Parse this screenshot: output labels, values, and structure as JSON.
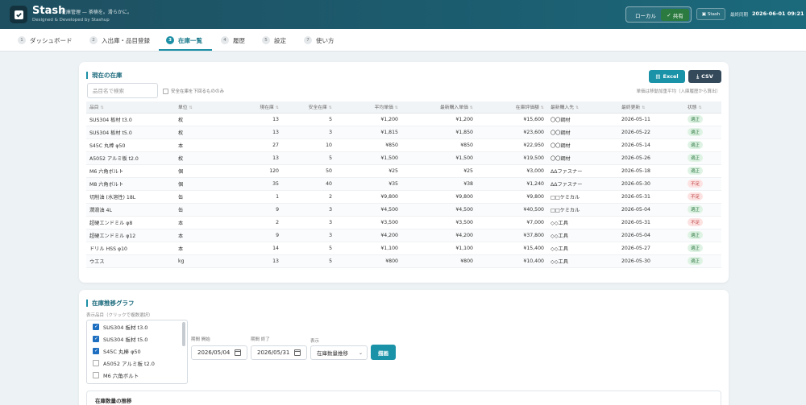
{
  "header": {
    "brand": "Stash",
    "tagline": "在庫管理 — 茶楠を。滑らかに。",
    "credit": "Designed & Developed by Stashup",
    "mode_local": "ローカル",
    "mode_shared": "共有",
    "stash_button": "Stash",
    "sync_label": "最終同期",
    "sync_time": "2026-06-01 09:21"
  },
  "tabs": [
    {
      "num": "1",
      "label": "ダッシュボード"
    },
    {
      "num": "2",
      "label": "入出庫・品目登録"
    },
    {
      "num": "3",
      "label": "在庫一覧"
    },
    {
      "num": "4",
      "label": "履歴"
    },
    {
      "num": "5",
      "label": "設定"
    },
    {
      "num": "7",
      "label": "使い方"
    }
  ],
  "inventory": {
    "title": "現在の在庫",
    "search_placeholder": "品目名で検索",
    "safety_filter_label": "安全在庫を下回るもののみ",
    "excel_label": "Excel",
    "csv_label": "CSV",
    "unit_note": "単価は移動加重平均（入庫履歴から算出）",
    "columns": [
      "品目",
      "単位",
      "現在庫",
      "安全在庫",
      "平均単価",
      "最新購入単価",
      "在庫評価額",
      "最新購入先",
      "最終更新",
      "状態"
    ],
    "rows": [
      [
        "SUS304 板材 t3.0",
        "枚",
        "13",
        "5",
        "¥1,200",
        "¥1,200",
        "¥15,600",
        "〇〇鋼材",
        "2026-05-11",
        "適正"
      ],
      [
        "SUS304 板材 t5.0",
        "枚",
        "13",
        "3",
        "¥1,815",
        "¥1,850",
        "¥23,600",
        "〇〇鋼材",
        "2026-05-22",
        "適正"
      ],
      [
        "S45C 丸棒 φ50",
        "本",
        "27",
        "10",
        "¥850",
        "¥850",
        "¥22,950",
        "〇〇鋼材",
        "2026-05-14",
        "適正"
      ],
      [
        "A5052 アルミ板 t2.0",
        "枚",
        "13",
        "5",
        "¥1,500",
        "¥1,500",
        "¥19,500",
        "〇〇鋼材",
        "2026-05-26",
        "適正"
      ],
      [
        "M6 六角ボルト",
        "個",
        "120",
        "50",
        "¥25",
        "¥25",
        "¥3,000",
        "ΔΔファスナー",
        "2026-05-18",
        "適正"
      ],
      [
        "M8 六角ボルト",
        "個",
        "35",
        "40",
        "¥35",
        "¥38",
        "¥1,240",
        "ΔΔファスナー",
        "2026-05-30",
        "不足"
      ],
      [
        "切削油 (水溶性) 18L",
        "缶",
        "1",
        "2",
        "¥9,800",
        "¥9,800",
        "¥9,800",
        "□□ケミカル",
        "2026-05-31",
        "不足"
      ],
      [
        "潤滑油 4L",
        "缶",
        "9",
        "3",
        "¥4,500",
        "¥4,500",
        "¥40,500",
        "□□ケミカル",
        "2026-05-04",
        "適正"
      ],
      [
        "超硬エンドミル φ8",
        "本",
        "2",
        "3",
        "¥3,500",
        "¥3,500",
        "¥7,000",
        "◇◇工具",
        "2026-05-31",
        "不足"
      ],
      [
        "超硬エンドミル φ12",
        "本",
        "9",
        "3",
        "¥4,200",
        "¥4,200",
        "¥37,800",
        "◇◇工具",
        "2026-05-04",
        "適正"
      ],
      [
        "ドリル HSS φ10",
        "本",
        "14",
        "5",
        "¥1,100",
        "¥1,100",
        "¥15,400",
        "◇◇工具",
        "2026-05-27",
        "適正"
      ],
      [
        "ウエス",
        "kg",
        "13",
        "5",
        "¥800",
        "¥800",
        "¥10,400",
        "◇◇工具",
        "2026-05-30",
        "適正"
      ]
    ]
  },
  "trend": {
    "title": "在庫推移グラフ",
    "hint": "表示品目（クリックで複数選択）",
    "items": [
      {
        "label": "SUS304 板材 t3.0",
        "checked": true
      },
      {
        "label": "SUS304 板材 t5.0",
        "checked": true
      },
      {
        "label": "S45C 丸棒 φ50",
        "checked": true
      },
      {
        "label": "A5052 アルミ板 t2.0",
        "checked": false
      },
      {
        "label": "M6 六角ボルト",
        "checked": false
      }
    ],
    "start_label": "期間 開始",
    "start_value": "2026/05/04",
    "end_label": "期間 終了",
    "end_value": "2026/05/31",
    "view_label": "表示",
    "view_value": "在庫数量推移",
    "draw_label": "描画",
    "subpanel_title": "在庫数量の推移"
  },
  "colors": {
    "accent": "#1a93a8",
    "header": "#1e4f60",
    "ok_badge": "#dff3e4",
    "low_badge": "#fde2e2"
  }
}
